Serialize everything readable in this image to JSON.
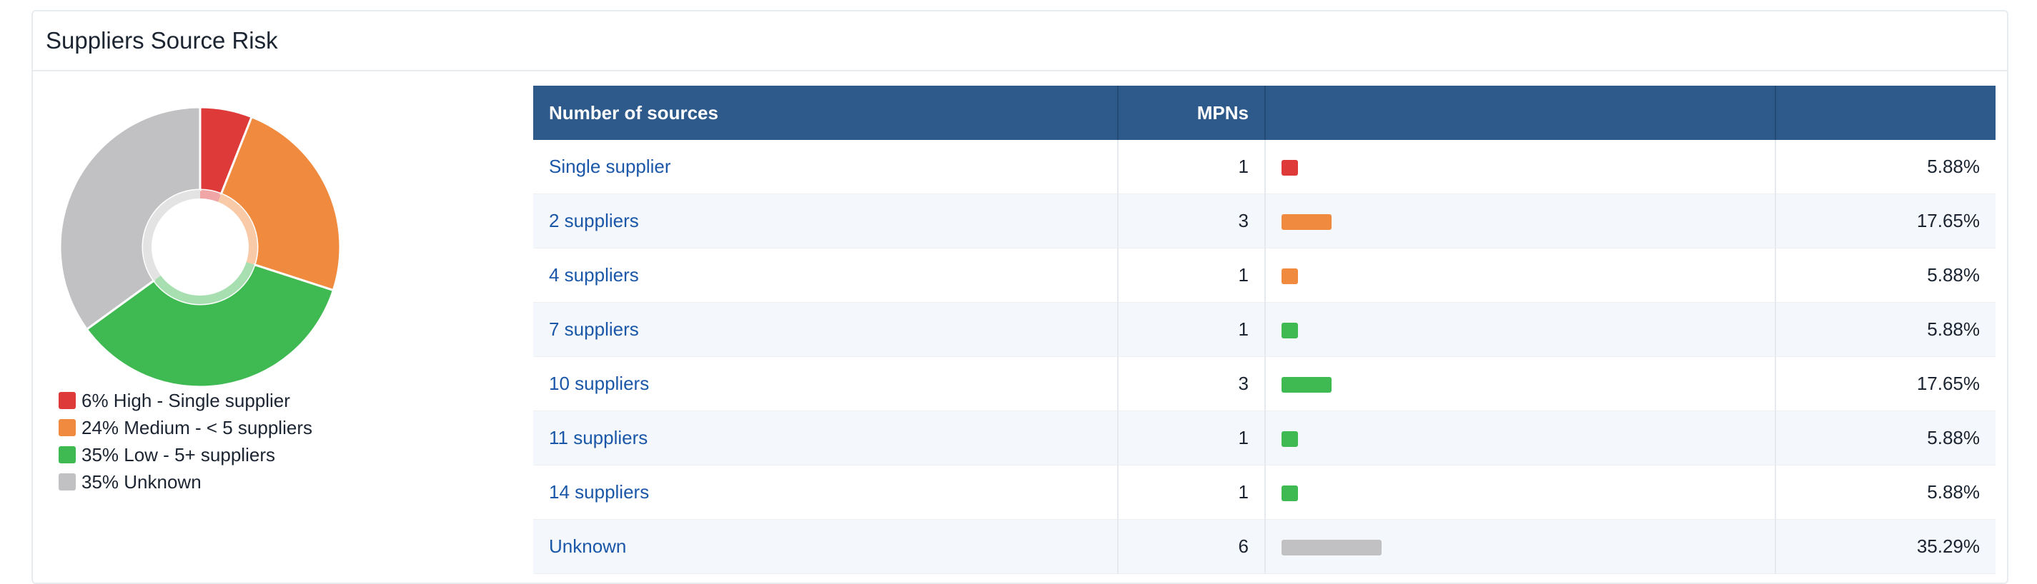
{
  "title": "Suppliers Source Risk",
  "legend": [
    {
      "label": "6% High - Single supplier",
      "color": "#de3a3a"
    },
    {
      "label": "24% Medium - < 5 suppliers",
      "color": "#f08a3e"
    },
    {
      "label": "35% Low - 5+ suppliers",
      "color": "#3fb951"
    },
    {
      "label": "35% Unknown",
      "color": "#c1c1c3"
    }
  ],
  "chart_data": {
    "type": "pie",
    "categories": [
      "High - Single supplier",
      "Medium - < 5 suppliers",
      "Low - 5+ suppliers",
      "Unknown"
    ],
    "values": [
      6,
      24,
      35,
      35
    ],
    "colors": [
      "#de3a3a",
      "#f08a3e",
      "#3fb951",
      "#c1c1c3"
    ]
  },
  "table": {
    "headers": [
      "Number of sources",
      "MPNs",
      "",
      ""
    ],
    "rows": [
      {
        "label": "Single supplier",
        "mpns": "1",
        "percent": "5.88%",
        "share": 0.0588,
        "color": "#de3a3a"
      },
      {
        "label": "2 suppliers",
        "mpns": "3",
        "percent": "17.65%",
        "share": 0.1765,
        "color": "#f08a3e"
      },
      {
        "label": "4 suppliers",
        "mpns": "1",
        "percent": "5.88%",
        "share": 0.0588,
        "color": "#f08a3e"
      },
      {
        "label": "7 suppliers",
        "mpns": "1",
        "percent": "5.88%",
        "share": 0.0588,
        "color": "#3fb951"
      },
      {
        "label": "10 suppliers",
        "mpns": "3",
        "percent": "17.65%",
        "share": 0.1765,
        "color": "#3fb951"
      },
      {
        "label": "11 suppliers",
        "mpns": "1",
        "percent": "5.88%",
        "share": 0.0588,
        "color": "#3fb951"
      },
      {
        "label": "14 suppliers",
        "mpns": "1",
        "percent": "5.88%",
        "share": 0.0588,
        "color": "#3fb951"
      },
      {
        "label": "Unknown",
        "mpns": "6",
        "percent": "35.29%",
        "share": 0.3529,
        "color": "#c1c1c3"
      }
    ]
  }
}
